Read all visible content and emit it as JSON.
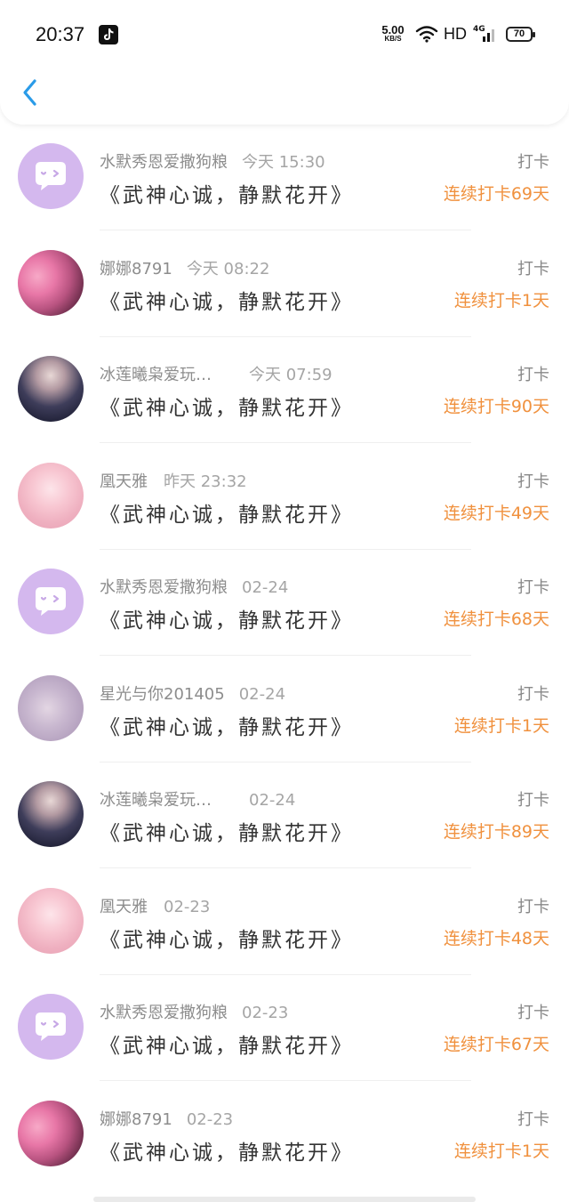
{
  "status_bar": {
    "time": "20:37",
    "net_speed_value": "5.00",
    "net_speed_unit": "KB/S",
    "hd": "HD",
    "signal": "4G",
    "battery": "70"
  },
  "header": {
    "back_icon": "chevron-left-icon",
    "accent_color": "#2a9be8"
  },
  "colors": {
    "streak": "#f0913e",
    "purple_avatar": "#d4b8ee"
  },
  "checkins": [
    {
      "name": "水默秀恩爱撒狗粮",
      "time": "今天 15:30",
      "book": "《武神心诚，静默花开》",
      "action": "打卡",
      "streak": "连续打卡69天",
      "avatar": "purple"
    },
    {
      "name": "娜娜8791",
      "time": "今天 08:22",
      "book": "《武神心诚，静默花开》",
      "action": "打卡",
      "streak": "连续打卡1天",
      "avatar": "flower"
    },
    {
      "name": "冰莲曦枭爱玩…",
      "time": "今天 07:59",
      "book": "《武神心诚，静默花开》",
      "action": "打卡",
      "streak": "连续打卡90天",
      "avatar": "dark"
    },
    {
      "name": "凰天雅",
      "time": "昨天 23:32",
      "book": "《武神心诚，静默花开》",
      "action": "打卡",
      "streak": "连续打卡49天",
      "avatar": "pink"
    },
    {
      "name": "水默秀恩爱撒狗粮",
      "time": "02-24",
      "book": "《武神心诚，静默花开》",
      "action": "打卡",
      "streak": "连续打卡68天",
      "avatar": "purple"
    },
    {
      "name": "星光与你201405",
      "time": "02-24",
      "book": "《武神心诚，静默花开》",
      "action": "打卡",
      "streak": "连续打卡1天",
      "avatar": "blur"
    },
    {
      "name": "冰莲曦枭爱玩…",
      "time": "02-24",
      "book": "《武神心诚，静默花开》",
      "action": "打卡",
      "streak": "连续打卡89天",
      "avatar": "dark"
    },
    {
      "name": "凰天雅",
      "time": "02-23",
      "book": "《武神心诚，静默花开》",
      "action": "打卡",
      "streak": "连续打卡48天",
      "avatar": "pink"
    },
    {
      "name": "水默秀恩爱撒狗粮",
      "time": "02-23",
      "book": "《武神心诚，静默花开》",
      "action": "打卡",
      "streak": "连续打卡67天",
      "avatar": "purple"
    },
    {
      "name": "娜娜8791",
      "time": "02-23",
      "book": "《武神心诚，静默花开》",
      "action": "打卡",
      "streak": "连续打卡1天",
      "avatar": "flower"
    }
  ]
}
